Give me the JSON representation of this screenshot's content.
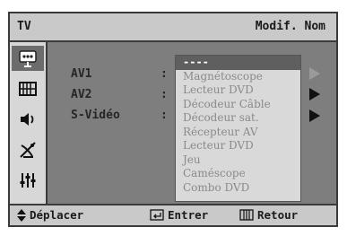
{
  "titlebar": {
    "source": "TV",
    "title": "Modif. Nom"
  },
  "sidebar": {
    "icons": [
      {
        "name": "input-icon",
        "active": true
      },
      {
        "name": "picture-icon",
        "active": false
      },
      {
        "name": "sound-icon",
        "active": false
      },
      {
        "name": "channel-icon",
        "active": false
      },
      {
        "name": "setup-icon",
        "active": false
      }
    ]
  },
  "rows": [
    {
      "label": "AV1",
      "colon": ":"
    },
    {
      "label": "AV2",
      "colon": ":"
    },
    {
      "label": "S-Vidéo",
      "colon": ":"
    }
  ],
  "dropdown": {
    "options": [
      "----",
      "Magnétoscope",
      "Lecteur DVD",
      "Décodeur Câble",
      "Décodeur sat.",
      "Récepteur AV",
      "Lecteur DVD",
      "Jeu",
      "Caméscope",
      "Combo DVD"
    ],
    "selected_index": 0
  },
  "footer": {
    "move_label": "Déplacer",
    "enter_label": "Entrer",
    "return_label": "Retour"
  },
  "colors": {
    "frame": "#dcdcdc",
    "content": "#7e7e7e",
    "highlight": "#5f5f5f"
  }
}
